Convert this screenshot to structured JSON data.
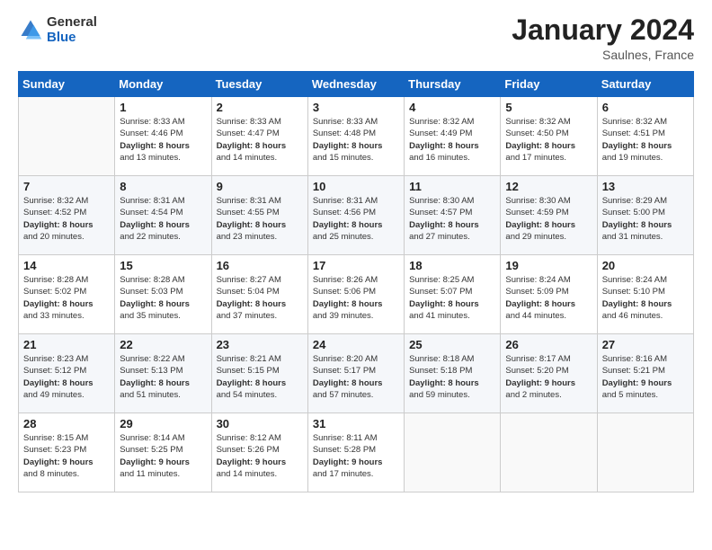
{
  "header": {
    "logo_general": "General",
    "logo_blue": "Blue",
    "title": "January 2024",
    "subtitle": "Saulnes, France"
  },
  "columns": [
    "Sunday",
    "Monday",
    "Tuesday",
    "Wednesday",
    "Thursday",
    "Friday",
    "Saturday"
  ],
  "weeks": [
    {
      "days": [
        {
          "num": "",
          "info": ""
        },
        {
          "num": "1",
          "info": "Sunrise: 8:33 AM\nSunset: 4:46 PM\nDaylight: 8 hours\nand 13 minutes."
        },
        {
          "num": "2",
          "info": "Sunrise: 8:33 AM\nSunset: 4:47 PM\nDaylight: 8 hours\nand 14 minutes."
        },
        {
          "num": "3",
          "info": "Sunrise: 8:33 AM\nSunset: 4:48 PM\nDaylight: 8 hours\nand 15 minutes."
        },
        {
          "num": "4",
          "info": "Sunrise: 8:32 AM\nSunset: 4:49 PM\nDaylight: 8 hours\nand 16 minutes."
        },
        {
          "num": "5",
          "info": "Sunrise: 8:32 AM\nSunset: 4:50 PM\nDaylight: 8 hours\nand 17 minutes."
        },
        {
          "num": "6",
          "info": "Sunrise: 8:32 AM\nSunset: 4:51 PM\nDaylight: 8 hours\nand 19 minutes."
        }
      ]
    },
    {
      "days": [
        {
          "num": "7",
          "info": "Sunrise: 8:32 AM\nSunset: 4:52 PM\nDaylight: 8 hours\nand 20 minutes."
        },
        {
          "num": "8",
          "info": "Sunrise: 8:31 AM\nSunset: 4:54 PM\nDaylight: 8 hours\nand 22 minutes."
        },
        {
          "num": "9",
          "info": "Sunrise: 8:31 AM\nSunset: 4:55 PM\nDaylight: 8 hours\nand 23 minutes."
        },
        {
          "num": "10",
          "info": "Sunrise: 8:31 AM\nSunset: 4:56 PM\nDaylight: 8 hours\nand 25 minutes."
        },
        {
          "num": "11",
          "info": "Sunrise: 8:30 AM\nSunset: 4:57 PM\nDaylight: 8 hours\nand 27 minutes."
        },
        {
          "num": "12",
          "info": "Sunrise: 8:30 AM\nSunset: 4:59 PM\nDaylight: 8 hours\nand 29 minutes."
        },
        {
          "num": "13",
          "info": "Sunrise: 8:29 AM\nSunset: 5:00 PM\nDaylight: 8 hours\nand 31 minutes."
        }
      ]
    },
    {
      "days": [
        {
          "num": "14",
          "info": "Sunrise: 8:28 AM\nSunset: 5:02 PM\nDaylight: 8 hours\nand 33 minutes."
        },
        {
          "num": "15",
          "info": "Sunrise: 8:28 AM\nSunset: 5:03 PM\nDaylight: 8 hours\nand 35 minutes."
        },
        {
          "num": "16",
          "info": "Sunrise: 8:27 AM\nSunset: 5:04 PM\nDaylight: 8 hours\nand 37 minutes."
        },
        {
          "num": "17",
          "info": "Sunrise: 8:26 AM\nSunset: 5:06 PM\nDaylight: 8 hours\nand 39 minutes."
        },
        {
          "num": "18",
          "info": "Sunrise: 8:25 AM\nSunset: 5:07 PM\nDaylight: 8 hours\nand 41 minutes."
        },
        {
          "num": "19",
          "info": "Sunrise: 8:24 AM\nSunset: 5:09 PM\nDaylight: 8 hours\nand 44 minutes."
        },
        {
          "num": "20",
          "info": "Sunrise: 8:24 AM\nSunset: 5:10 PM\nDaylight: 8 hours\nand 46 minutes."
        }
      ]
    },
    {
      "days": [
        {
          "num": "21",
          "info": "Sunrise: 8:23 AM\nSunset: 5:12 PM\nDaylight: 8 hours\nand 49 minutes."
        },
        {
          "num": "22",
          "info": "Sunrise: 8:22 AM\nSunset: 5:13 PM\nDaylight: 8 hours\nand 51 minutes."
        },
        {
          "num": "23",
          "info": "Sunrise: 8:21 AM\nSunset: 5:15 PM\nDaylight: 8 hours\nand 54 minutes."
        },
        {
          "num": "24",
          "info": "Sunrise: 8:20 AM\nSunset: 5:17 PM\nDaylight: 8 hours\nand 57 minutes."
        },
        {
          "num": "25",
          "info": "Sunrise: 8:18 AM\nSunset: 5:18 PM\nDaylight: 8 hours\nand 59 minutes."
        },
        {
          "num": "26",
          "info": "Sunrise: 8:17 AM\nSunset: 5:20 PM\nDaylight: 9 hours\nand 2 minutes."
        },
        {
          "num": "27",
          "info": "Sunrise: 8:16 AM\nSunset: 5:21 PM\nDaylight: 9 hours\nand 5 minutes."
        }
      ]
    },
    {
      "days": [
        {
          "num": "28",
          "info": "Sunrise: 8:15 AM\nSunset: 5:23 PM\nDaylight: 9 hours\nand 8 minutes."
        },
        {
          "num": "29",
          "info": "Sunrise: 8:14 AM\nSunset: 5:25 PM\nDaylight: 9 hours\nand 11 minutes."
        },
        {
          "num": "30",
          "info": "Sunrise: 8:12 AM\nSunset: 5:26 PM\nDaylight: 9 hours\nand 14 minutes."
        },
        {
          "num": "31",
          "info": "Sunrise: 8:11 AM\nSunset: 5:28 PM\nDaylight: 9 hours\nand 17 minutes."
        },
        {
          "num": "",
          "info": ""
        },
        {
          "num": "",
          "info": ""
        },
        {
          "num": "",
          "info": ""
        }
      ]
    }
  ]
}
